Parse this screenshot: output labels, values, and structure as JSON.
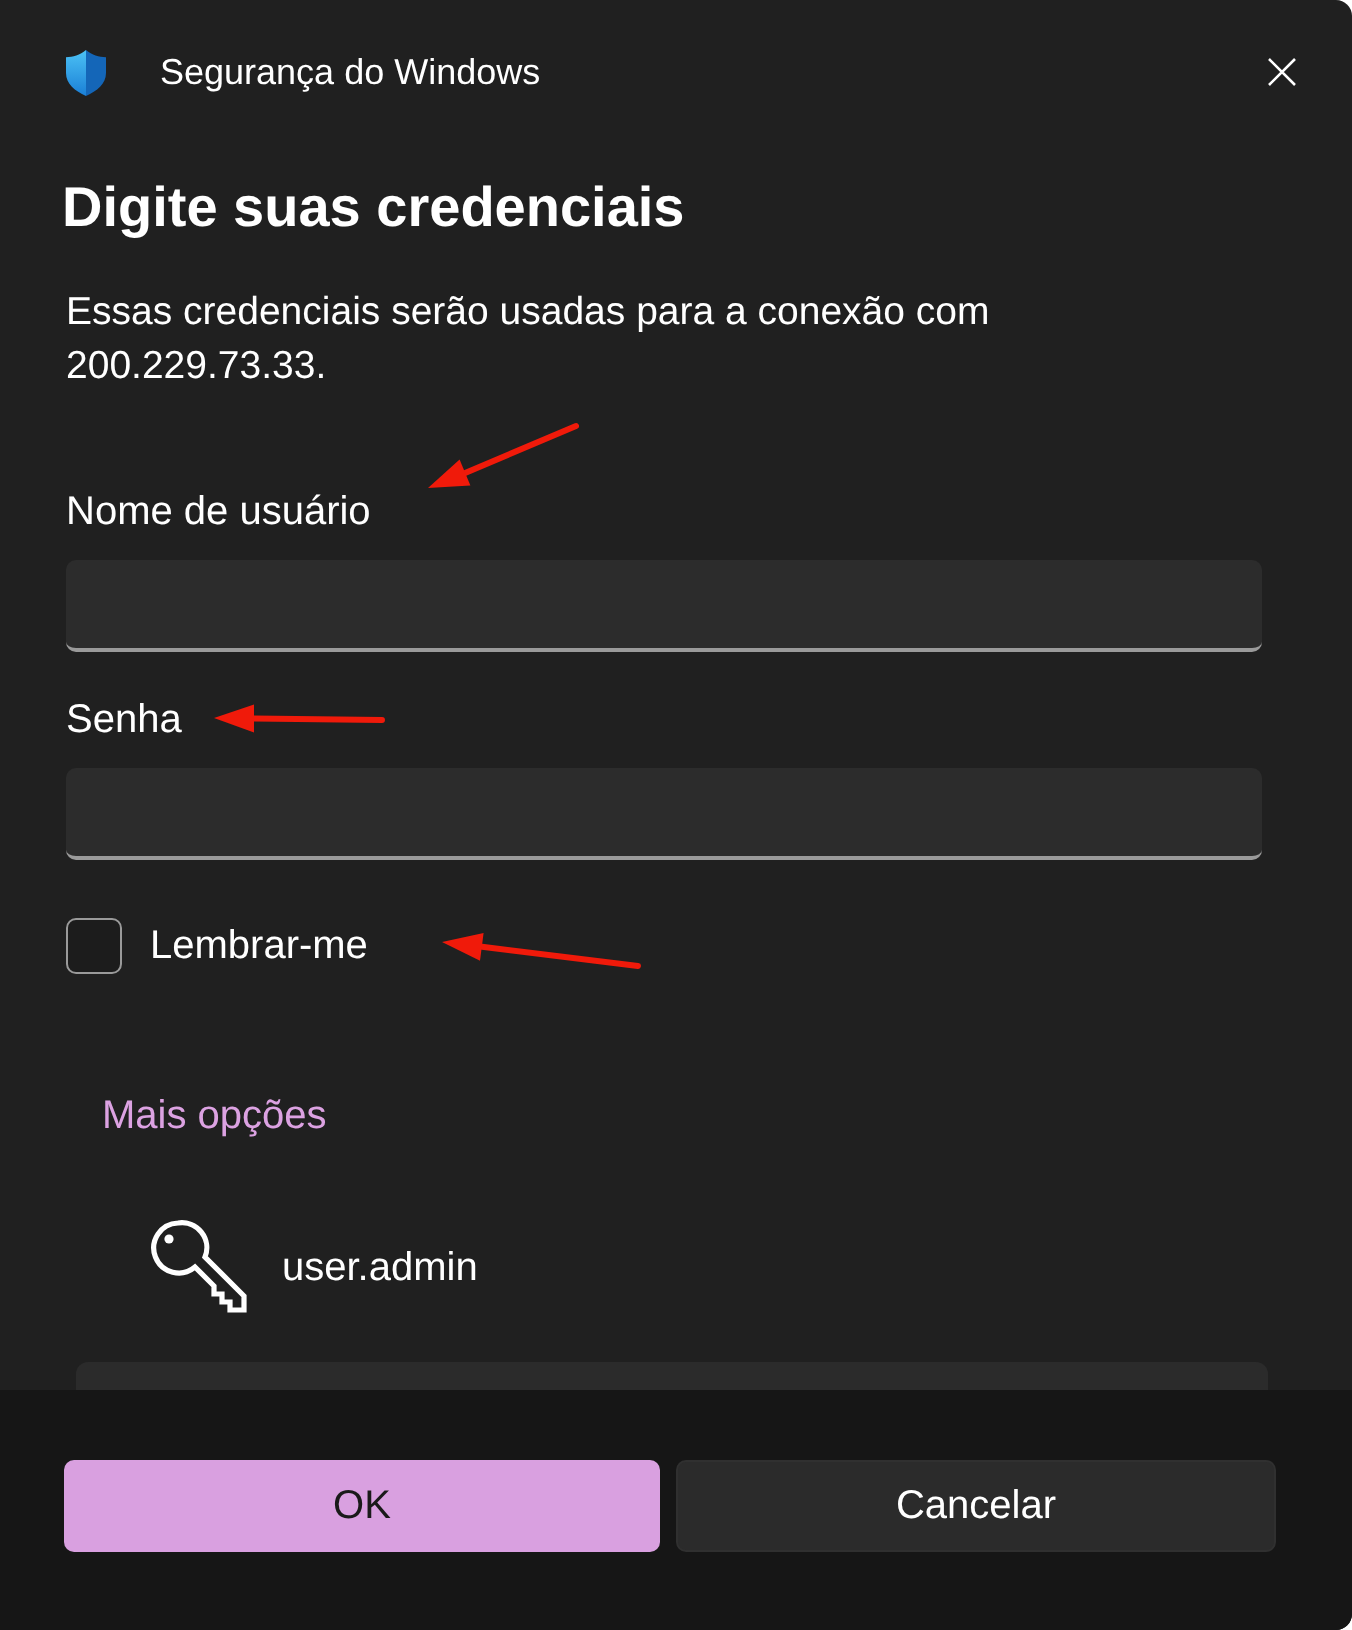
{
  "window": {
    "title": "Segurança do Windows"
  },
  "heading": "Digite suas credenciais",
  "description": "Essas credenciais serão usadas para a conexão com 200.229.73.33.",
  "fields": [
    {
      "label": "Nome de usuário",
      "arrow": {
        "kind": "falling"
      }
    },
    {
      "label": "Senha",
      "arrow": {
        "kind": "level"
      }
    }
  ],
  "remember": {
    "label": "Lembrar-me",
    "checked": false,
    "arrow": {
      "kind": "rising"
    }
  },
  "more_options": {
    "label": "Mais opções"
  },
  "credential": {
    "name": "user.admin"
  },
  "buttons": [
    {
      "label": "OK",
      "kind": "primary"
    },
    {
      "label": "Cancelar",
      "kind": "secondary"
    }
  ]
}
